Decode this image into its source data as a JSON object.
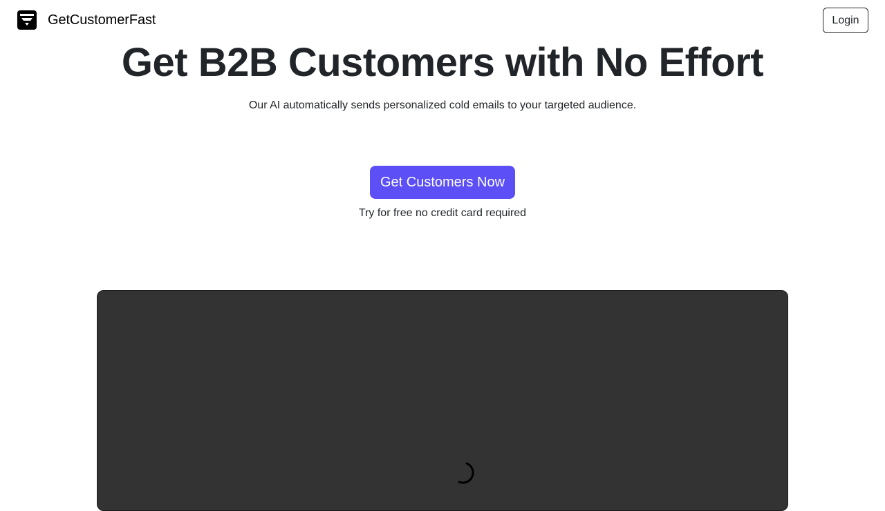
{
  "nav": {
    "brand_name": "GetCustomerFast",
    "brand_icon": "funnel-logo-icon",
    "login_label": "Login"
  },
  "hero": {
    "title": "Get B2B Customers with No Effort",
    "subtitle": "Our AI automatically sends personalized cold emails to your targeted audience.",
    "cta_label": "Get Customers Now",
    "cta_note": "Try for free no credit card required"
  },
  "media": {
    "loading_icon": "loading-spinner-icon"
  },
  "colors": {
    "accent": "#5b4ff5",
    "text": "#212529",
    "video_bg": "#333333",
    "background": "#ffffff"
  }
}
